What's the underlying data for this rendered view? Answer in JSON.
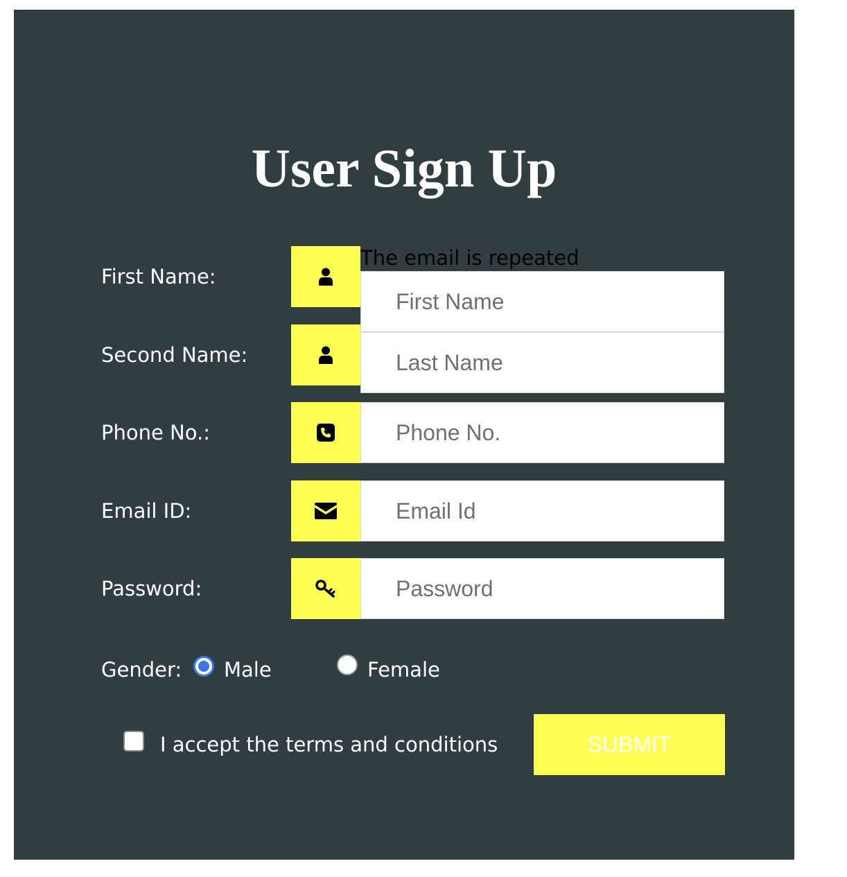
{
  "form": {
    "title": "User Sign Up",
    "error_message": "The email is repeated",
    "fields": {
      "first_name": {
        "label": "First Name:",
        "placeholder": "First Name",
        "icon": "user-icon"
      },
      "second_name": {
        "label": "Second Name:",
        "placeholder": "Last Name",
        "icon": "user-icon"
      },
      "phone": {
        "label": "Phone No.:",
        "placeholder": "Phone No.",
        "icon": "phone-icon"
      },
      "email": {
        "label": "Email ID:",
        "placeholder": "Email Id",
        "icon": "envelope-icon"
      },
      "password": {
        "label": "Password:",
        "placeholder": "Password",
        "icon": "key-icon"
      }
    },
    "gender": {
      "label": "Gender:",
      "options": [
        {
          "label": "Male",
          "checked": true
        },
        {
          "label": "Female",
          "checked": false
        }
      ]
    },
    "terms": {
      "label": "I accept the terms and conditions",
      "checked": false
    },
    "submit_label": "SUBMIT"
  },
  "colors": {
    "panel_background": "#313e3f",
    "accent_yellow": "#ffff54",
    "radio_selected": "#3b78e7",
    "text_light": "#ffffff"
  }
}
